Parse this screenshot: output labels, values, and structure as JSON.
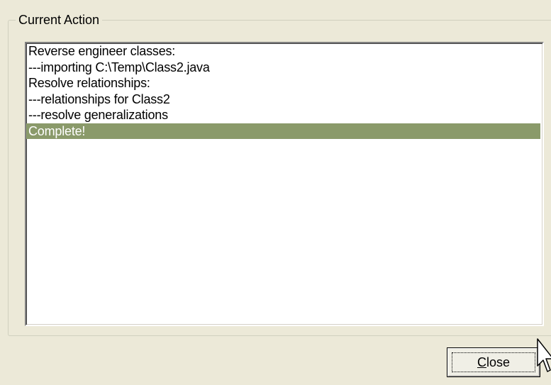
{
  "group": {
    "title": "Current Action"
  },
  "log": {
    "lines": [
      "Reverse engineer classes:",
      "---importing C:\\Temp\\Class2.java",
      "Resolve relationships:",
      "---relationships for Class2",
      "---resolve generalizations",
      "Complete!"
    ],
    "selected_index": 5
  },
  "buttons": {
    "close_mnemonic": "C",
    "close_rest": "lose"
  },
  "colors": {
    "dialog_bg": "#ece9d8",
    "selection_bg": "#8a9a6a",
    "selection_text": "#ffffff"
  },
  "icons": {
    "cursor": "arrow-pointer-icon"
  }
}
